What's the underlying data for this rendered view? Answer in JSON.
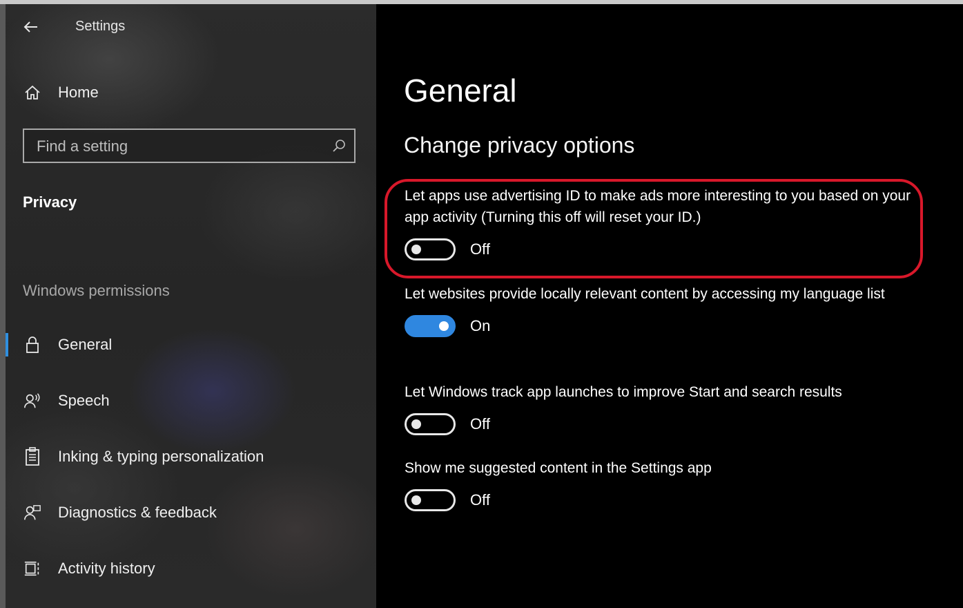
{
  "app": {
    "title": "Settings",
    "back_icon": "back-arrow-icon"
  },
  "sidebar": {
    "home_label": "Home",
    "search_placeholder": "Find a setting",
    "section_title": "Privacy",
    "group_title": "Windows permissions",
    "items": [
      {
        "label": "General",
        "icon": "lock-icon",
        "selected": true
      },
      {
        "label": "Speech",
        "icon": "speech-icon",
        "selected": false
      },
      {
        "label": "Inking & typing personalization",
        "icon": "clipboard-icon",
        "selected": false
      },
      {
        "label": "Diagnostics & feedback",
        "icon": "feedback-icon",
        "selected": false
      },
      {
        "label": "Activity history",
        "icon": "activity-history-icon",
        "selected": false
      }
    ]
  },
  "main": {
    "title": "General",
    "subtitle": "Change privacy options",
    "settings": [
      {
        "description": "Let apps use advertising ID to make ads more interesting to you based on your app activity (Turning this off will reset your ID.)",
        "state": "Off",
        "on": false,
        "highlighted": true
      },
      {
        "description": "Let websites provide locally relevant content by accessing my language list",
        "state": "On",
        "on": true,
        "highlighted": false
      },
      {
        "description": "Let Windows track app launches to improve Start and search results",
        "state": "Off",
        "on": false,
        "highlighted": false
      },
      {
        "description": "Show me suggested content in the Settings app",
        "state": "Off",
        "on": false,
        "highlighted": false
      }
    ]
  },
  "colors": {
    "accent": "#2f87e0",
    "highlight": "#d8182a",
    "background": "#000000"
  }
}
